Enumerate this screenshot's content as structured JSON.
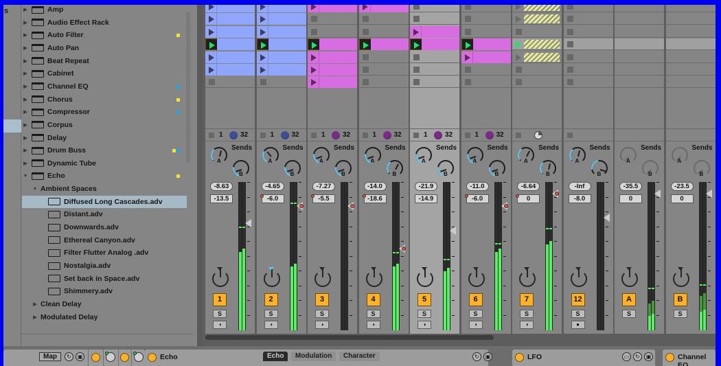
{
  "browser": {
    "places_cut_label": "s",
    "items": [
      {
        "label": "Amp",
        "type": "device",
        "expanded": false,
        "tags": []
      },
      {
        "label": "Audio Effect Rack",
        "type": "device",
        "expanded": false,
        "tags": []
      },
      {
        "label": "Auto Filter",
        "type": "device",
        "expanded": false,
        "tags": [
          "#f2e62b"
        ]
      },
      {
        "label": "Auto Pan",
        "type": "device",
        "expanded": false,
        "tags": []
      },
      {
        "label": "Beat Repeat",
        "type": "device",
        "expanded": false,
        "tags": []
      },
      {
        "label": "Cabinet",
        "type": "device",
        "expanded": false,
        "tags": []
      },
      {
        "label": "Channel EQ",
        "type": "device",
        "expanded": false,
        "tags": [
          "#1ba7e8"
        ]
      },
      {
        "label": "Chorus",
        "type": "device",
        "expanded": false,
        "tags": [
          "#f2e62b"
        ]
      },
      {
        "label": "Compressor",
        "type": "device",
        "expanded": false,
        "tags": [
          "#1ba7e8"
        ]
      },
      {
        "label": "Corpus",
        "type": "device",
        "expanded": false,
        "tags": []
      },
      {
        "label": "Delay",
        "type": "device",
        "expanded": false,
        "tags": []
      },
      {
        "label": "Drum Buss",
        "type": "device",
        "expanded": false,
        "tags": [
          "#f2e62b",
          "#1ba7e8"
        ]
      },
      {
        "label": "Dynamic Tube",
        "type": "device",
        "expanded": false,
        "tags": []
      },
      {
        "label": "Echo",
        "type": "device",
        "expanded": true,
        "tags": [
          "#f2e62b"
        ]
      },
      {
        "label": "Ambient Spaces",
        "type": "folder",
        "expanded": true,
        "level": 1
      },
      {
        "label": "Diffused Long Cascades.adv",
        "type": "preset",
        "level": 2,
        "selected": true
      },
      {
        "label": "Distant.adv",
        "type": "preset",
        "level": 2
      },
      {
        "label": "Downwards.adv",
        "type": "preset",
        "level": 2
      },
      {
        "label": "Ethereal Canyon.adv",
        "type": "preset",
        "level": 2
      },
      {
        "label": "Filter Flutter Analog .adv",
        "type": "preset",
        "level": 2
      },
      {
        "label": "Nostalgia.adv",
        "type": "preset",
        "level": 2
      },
      {
        "label": "Set back in Space.adv",
        "type": "preset",
        "level": 2
      },
      {
        "label": "Shimmery.adv",
        "type": "preset",
        "level": 2
      },
      {
        "label": "Clean Delay",
        "type": "folder",
        "expanded": false,
        "level": 1
      },
      {
        "label": "Modulated Delay",
        "type": "folder",
        "expanded": false,
        "level": 1
      }
    ]
  },
  "tracks": [
    {
      "name": "1",
      "clips": [
        "blue",
        "blue",
        "blue",
        "blue-playing",
        "blue",
        "blue",
        "stop"
      ],
      "status": {
        "n1": "1",
        "n32": "32",
        "ball": "#3f4f95"
      },
      "sendA": 0.55,
      "sendB": 0.1,
      "volume": "-8.63",
      "pan_value": "-13.5",
      "pan_dot": false,
      "meter": 0.55,
      "peak": 0.69,
      "fader": 0.72,
      "fader_dot": false,
      "pan_marker": "default",
      "arm": "◑"
    },
    {
      "name": "2",
      "clips": [
        "blue",
        "blue",
        "blue",
        "blue-playing",
        "blue",
        "blue",
        "stop"
      ],
      "status": {
        "n1": "1",
        "n32": "32",
        "ball": "#3f4f95"
      },
      "sendA": 0.35,
      "sendB": 0.1,
      "volume": "-4.65",
      "pan_value": "-6.0",
      "pan_dot": true,
      "meter": 0.45,
      "peak": 0.85,
      "fader": 0.84,
      "fader_dot": true,
      "pan_marker": "blue",
      "arm": "◑"
    },
    {
      "name": "3",
      "clips": [
        "pink",
        "stop",
        "stop",
        "pink-playing",
        "pink",
        "pink",
        "pink"
      ],
      "status": {
        "n1": "1",
        "n32": "32",
        "ball": "#7a2b88"
      },
      "sendA": 0.1,
      "sendB": 0.1,
      "volume": "-7.27",
      "pan_value": "-5.5",
      "pan_dot": true,
      "meter": 0.0,
      "peak": 0.0,
      "fader": 0.84,
      "fader_dot": true,
      "pan_marker": "default",
      "arm": "◑"
    },
    {
      "name": "4",
      "clips": [
        "pink",
        "stop",
        "stop",
        "pink-playing",
        "stop",
        "stop",
        "stop"
      ],
      "status": {
        "n1": "1",
        "n32": "32",
        "ball": "#7a2b88"
      },
      "sendA": 0.1,
      "sendB": 0.6,
      "volume": "-14.0",
      "pan_value": "-18.6",
      "pan_dot": true,
      "meter": 0.45,
      "peak": 0.52,
      "fader": 0.55,
      "fader_dot": true,
      "pan_marker": "default",
      "arm": "◑"
    },
    {
      "name": "5",
      "clips": [
        "stop",
        "stop",
        "pink",
        "pink-playing",
        "stop",
        "stop",
        "stop"
      ],
      "selected": true,
      "status": {
        "n1": "1",
        "n32": "32",
        "ball": "#7a2b88"
      },
      "sendA": 0.1,
      "sendB": 0.1,
      "volume": "-21.9",
      "pan_value": "-14.9",
      "pan_dot": false,
      "meter": 0.42,
      "peak": 0.47,
      "fader": 0.67,
      "fader_dot": false,
      "pan_marker": "default",
      "arm": "◑"
    },
    {
      "name": "6",
      "clips": [
        "stop",
        "stop",
        "stop",
        "pink-playing",
        "pink",
        "stop",
        "stop"
      ],
      "status": {
        "n1": "1",
        "n32": "32",
        "ball": "#7a2b88"
      },
      "sendA": 0.1,
      "sendB": 0.1,
      "volume": "-11.0",
      "pan_value": "-6.0",
      "pan_dot": true,
      "meter": 0.55,
      "peak": 0.58,
      "fader": 0.84,
      "fader_dot": true,
      "pan_marker": "default",
      "arm": "◑"
    },
    {
      "name": "7",
      "clips": [
        "hatch",
        "hatch",
        "stop",
        "hatch-playing",
        "hatch",
        "stop",
        "stop"
      ],
      "status": {
        "n1": "",
        "n32": "",
        "ball": "#d9d9d9",
        "clock": true
      },
      "sendA": 0.6,
      "sendB": 0.55,
      "volume": "-6.64",
      "pan_value": "0",
      "pan_dot": true,
      "meter": 0.6,
      "peak": 0.68,
      "fader": 0.92,
      "fader_dot": true,
      "pan_marker": "default",
      "arm": "◑"
    },
    {
      "name": "12",
      "clips": [
        "stop",
        "stop",
        "stop",
        "stop-hl",
        "stop",
        "stop",
        "stop"
      ],
      "status": {
        "n1": "",
        "n32": "",
        "ball": null
      },
      "sendA": 0.55,
      "sendB": 0.9,
      "volume": "-Inf",
      "pan_value": "-8.0",
      "pan_dot": false,
      "meter": 0.0,
      "peak": 0.0,
      "fader": 0.76,
      "fader_dot": false,
      "pan_marker": "default",
      "arm": "●"
    },
    {
      "name": "A",
      "clips": [
        "none",
        "none",
        "none",
        "hl",
        "none",
        "none",
        "none"
      ],
      "return": true,
      "status": {
        "n1": "",
        "n32": "",
        "ball": null
      },
      "sendA": 0.0,
      "sendB": 0.0,
      "volume": "-35.5",
      "pan_value": "0",
      "pan_dot": false,
      "meter": 0.2,
      "peak": 0.28,
      "fader": 0.92,
      "fader_dot": false,
      "pan_marker": "default",
      "arm": null
    },
    {
      "name": "B",
      "clips": [
        "none",
        "none",
        "none",
        "hl",
        "none",
        "none",
        "none"
      ],
      "return": true,
      "status": {
        "n1": "",
        "n32": "",
        "ball": null
      },
      "sendA": 0.0,
      "sendB": 0.0,
      "volume": "-23.5",
      "pan_value": "0",
      "pan_dot": false,
      "meter": 0.25,
      "peak": 0.3,
      "fader": 0.92,
      "fader_dot": false,
      "pan_marker": "default",
      "arm": null
    }
  ],
  "mixer": {
    "sends_label": "Sends",
    "knob_a": "A",
    "knob_b": "B",
    "solo_label": "S"
  },
  "device_chain": {
    "map_label": "Map",
    "echo": {
      "title": "Echo",
      "tabs": [
        "Echo",
        "Modulation",
        "Character"
      ],
      "active_tab": "Echo"
    },
    "lfo": {
      "title": "LFO"
    },
    "channel_eq": {
      "title": "Channel EQ"
    }
  }
}
